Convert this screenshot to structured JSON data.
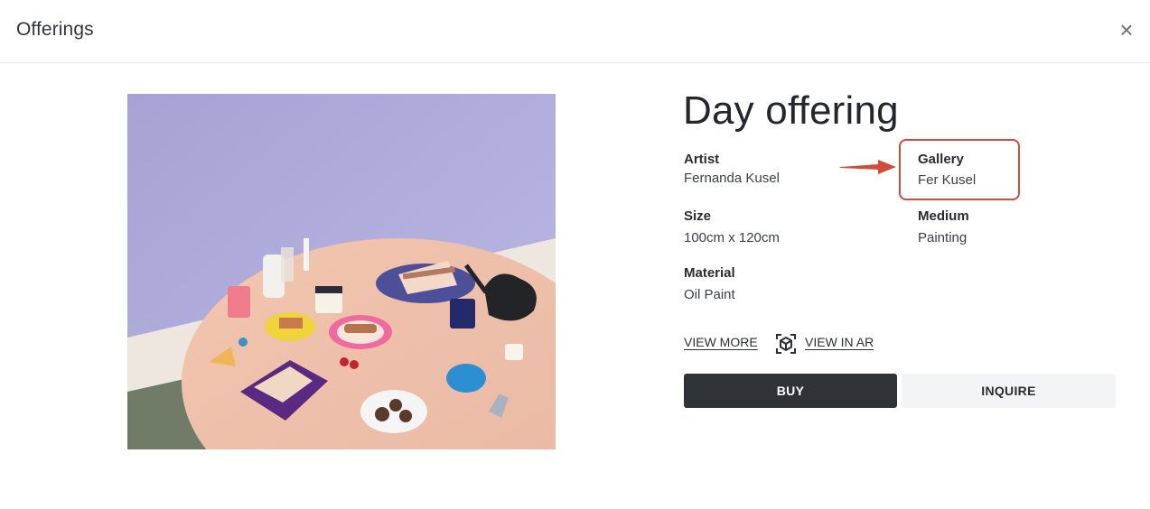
{
  "modal": {
    "title": "Offerings",
    "close_glyph": "×"
  },
  "artwork": {
    "image_alt": "Painting of a table with cake, coffee, pastries and drinks",
    "title": "Day offering",
    "artist_label": "Artist",
    "artist_value": "Fernanda Kusel",
    "gallery_label": "Gallery",
    "gallery_value": "Fer Kusel",
    "size_label": "Size",
    "size_value": "100cm x 120cm",
    "medium_label": "Medium",
    "medium_value": "Painting",
    "material_label": "Material",
    "material_value": "Oil Paint"
  },
  "actions": {
    "view_more": "VIEW MORE",
    "view_in_ar": "VIEW IN AR",
    "ar_icon": "ar-cube-icon",
    "buy": "BUY",
    "inquire": "INQUIRE"
  },
  "annotation": {
    "highlight_color": "#d24c3a"
  },
  "colors": {
    "buy_button_bg": "#2f3338",
    "inquire_button_bg": "#f3f4f5"
  }
}
